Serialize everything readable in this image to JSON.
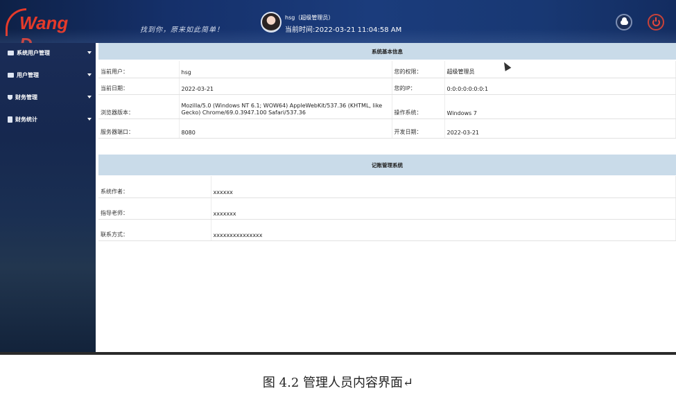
{
  "header": {
    "logo_text": "Wang D",
    "slogan": "找到你，原来如此简单！",
    "user": "hsg（超级管理员）",
    "time": "当前时间:2022-03-21 11:04:58 AM"
  },
  "sidebar": {
    "items": [
      {
        "label": "系统用户管理"
      },
      {
        "label": "用户管理"
      },
      {
        "label": "财务管理"
      },
      {
        "label": "财务统计"
      }
    ]
  },
  "system_info": {
    "title": "系统基本信息",
    "rows": [
      {
        "l1": "当前用户：",
        "v1": "hsg",
        "l2": "您的权限：",
        "v2": "超级管理员"
      },
      {
        "l1": "当前日期：",
        "v1": "2022-03-21",
        "l2": "您的IP：",
        "v2": "0:0:0:0:0:0:0:1"
      },
      {
        "l1": "浏览器版本：",
        "v1": "Mozilla/5.0 (Windows NT 6.1; WOW64) AppleWebKit/537.36 (KHTML, like Gecko) Chrome/69.0.3947.100 Safari/537.36",
        "l2": "操作系统：",
        "v2": "Windows 7"
      },
      {
        "l1": "服务器端口：",
        "v1": "8080",
        "l2": "开发日期：",
        "v2": "2022-03-21"
      }
    ]
  },
  "accounting": {
    "title": "记账管理系统",
    "rows": [
      {
        "l": "系统作者：",
        "v": "xxxxxx"
      },
      {
        "l": "指导老师：",
        "v": "xxxxxxx"
      },
      {
        "l": "联系方式：",
        "v": "xxxxxxxxxxxxxxx"
      }
    ]
  },
  "caption": "图 4.2 管理人员内容界面↵"
}
